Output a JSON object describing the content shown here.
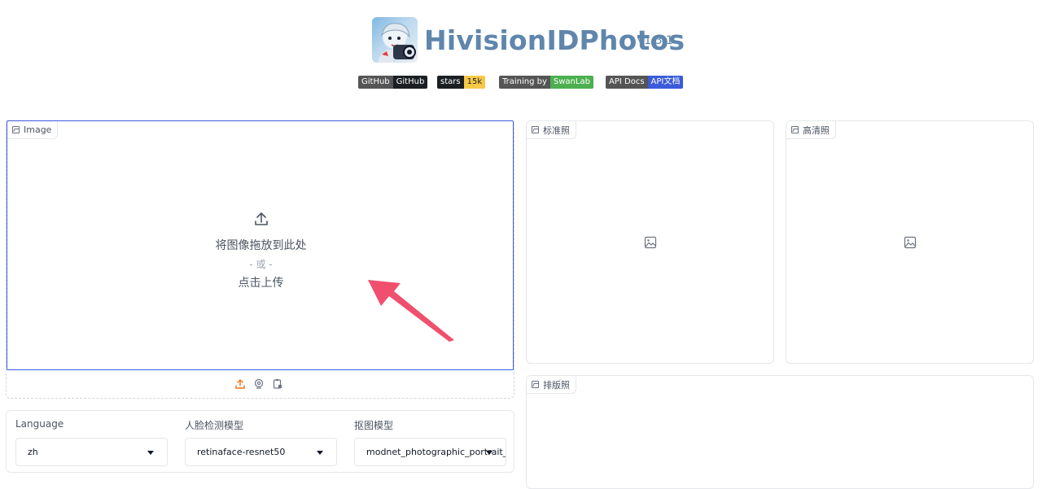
{
  "header": {
    "title": "HivisionIDPhotos",
    "version": "v1.3.1",
    "logo_icon": "anime-avatar-logo"
  },
  "badges": [
    {
      "left": "GitHub",
      "right": "GitHub",
      "left_color": "#555555",
      "right_color": "#1b1f23"
    },
    {
      "left": "stars",
      "right": "15k",
      "left_color": "#1b1f23",
      "right_color": "#f7c948"
    },
    {
      "left": "Training by",
      "right": "SwanLab",
      "left_color": "#555555",
      "right_color": "#4caf50"
    },
    {
      "left": "API Docs",
      "right": "API文档",
      "left_color": "#555555",
      "right_color": "#3b5bdb"
    }
  ],
  "upload": {
    "label": "Image",
    "drop_text": "将图像拖放到此处",
    "or_text": "- 或 -",
    "click_text": "点击上传"
  },
  "outputs": {
    "standard_label": "标准照",
    "hd_label": "高清照",
    "layout_label": "排版照"
  },
  "options": {
    "language_label": "Language",
    "language_value": "zh",
    "face_model_label": "人脸检测模型",
    "face_model_value": "retinaface-resnet50",
    "matting_model_label": "抠图模型",
    "matting_model_value": "modnet_photographic_portrait_matting"
  },
  "colors": {
    "accent": "#3b5bdb",
    "title": "#5f86ad",
    "upload_active": "#f97316",
    "arrow": "#f0506e"
  }
}
